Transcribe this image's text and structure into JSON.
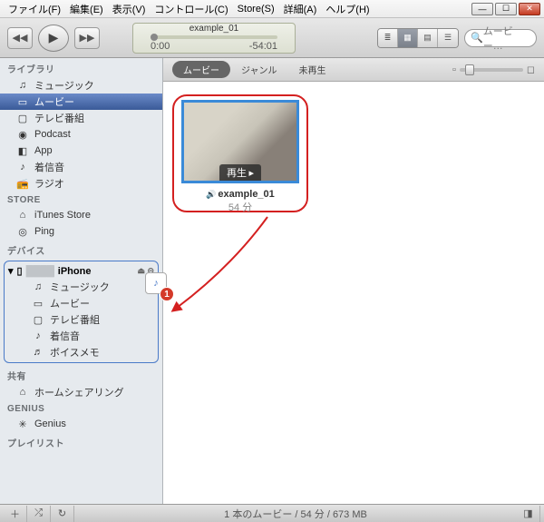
{
  "menu": {
    "file": "ファイル(F)",
    "edit": "編集(E)",
    "view": "表示(V)",
    "control": "コントロール(C)",
    "store": "Store(S)",
    "advanced": "詳細(A)",
    "help": "ヘルプ(H)"
  },
  "lcd": {
    "title": "example_01",
    "t0": "0:00",
    "t1": "-54:01"
  },
  "search": {
    "placeholder": "ムービー…"
  },
  "sidebar": {
    "hdr_library": "ライブラリ",
    "lib": {
      "music": "ミュージック",
      "movies": "ムービー",
      "tv": "テレビ番組",
      "podcast": "Podcast",
      "app": "App",
      "ringtone": "着信音",
      "radio": "ラジオ"
    },
    "hdr_store": "STORE",
    "store": {
      "itunes": "iTunes Store",
      "ping": "Ping"
    },
    "hdr_device": "デバイス",
    "device": {
      "name": "iPhone",
      "music": "ミュージック",
      "movies": "ムービー",
      "tv": "テレビ番組",
      "ringtone": "着信音",
      "voicememo": "ボイスメモ"
    },
    "hdr_shared": "共有",
    "shared": {
      "home": "ホームシェアリング"
    },
    "hdr_genius": "GENIUS",
    "genius": {
      "genius": "Genius"
    },
    "hdr_playlist": "プレイリスト"
  },
  "filter": {
    "movies": "ムービー",
    "genre": "ジャンル",
    "unplayed": "未再生"
  },
  "item": {
    "title": "example_01",
    "duration": "54 分",
    "play": "再生"
  },
  "badge": {
    "count": "1"
  },
  "status": {
    "text": "1 本のムービー / 54 分 / 673 MB"
  }
}
